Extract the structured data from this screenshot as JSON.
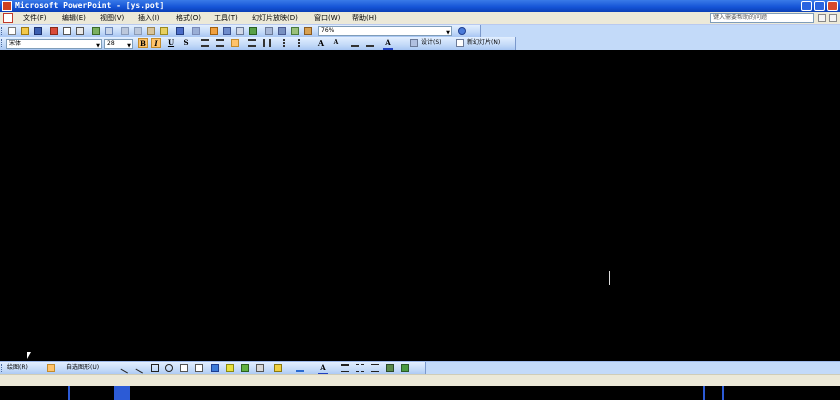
{
  "window": {
    "title": "Microsoft PowerPoint - [ys.pot]"
  },
  "menubar": {
    "items": [
      "文件(F)",
      "编辑(E)",
      "视图(V)",
      "插入(I)",
      "格式(O)",
      "工具(T)",
      "幻灯片放映(D)",
      "窗口(W)",
      "帮助(H)"
    ],
    "help_placeholder": "键入需要帮助的问题"
  },
  "standard_toolbar": {
    "zoom": "76%"
  },
  "formatting_toolbar": {
    "font": "宋体",
    "font_size": "28",
    "bold": "B",
    "italic": "I",
    "underline": "U",
    "shadow": "S",
    "design_label": "设计(S)",
    "new_slide_label": "新幻灯片(N)"
  },
  "drawing_toolbar": {
    "draw_label": "绘图(R)",
    "autoshapes_label": "自选图形(U)"
  },
  "colors": {
    "accent": "#1453d6",
    "toolbar": "#c3daf9",
    "canvas": "#000000"
  }
}
